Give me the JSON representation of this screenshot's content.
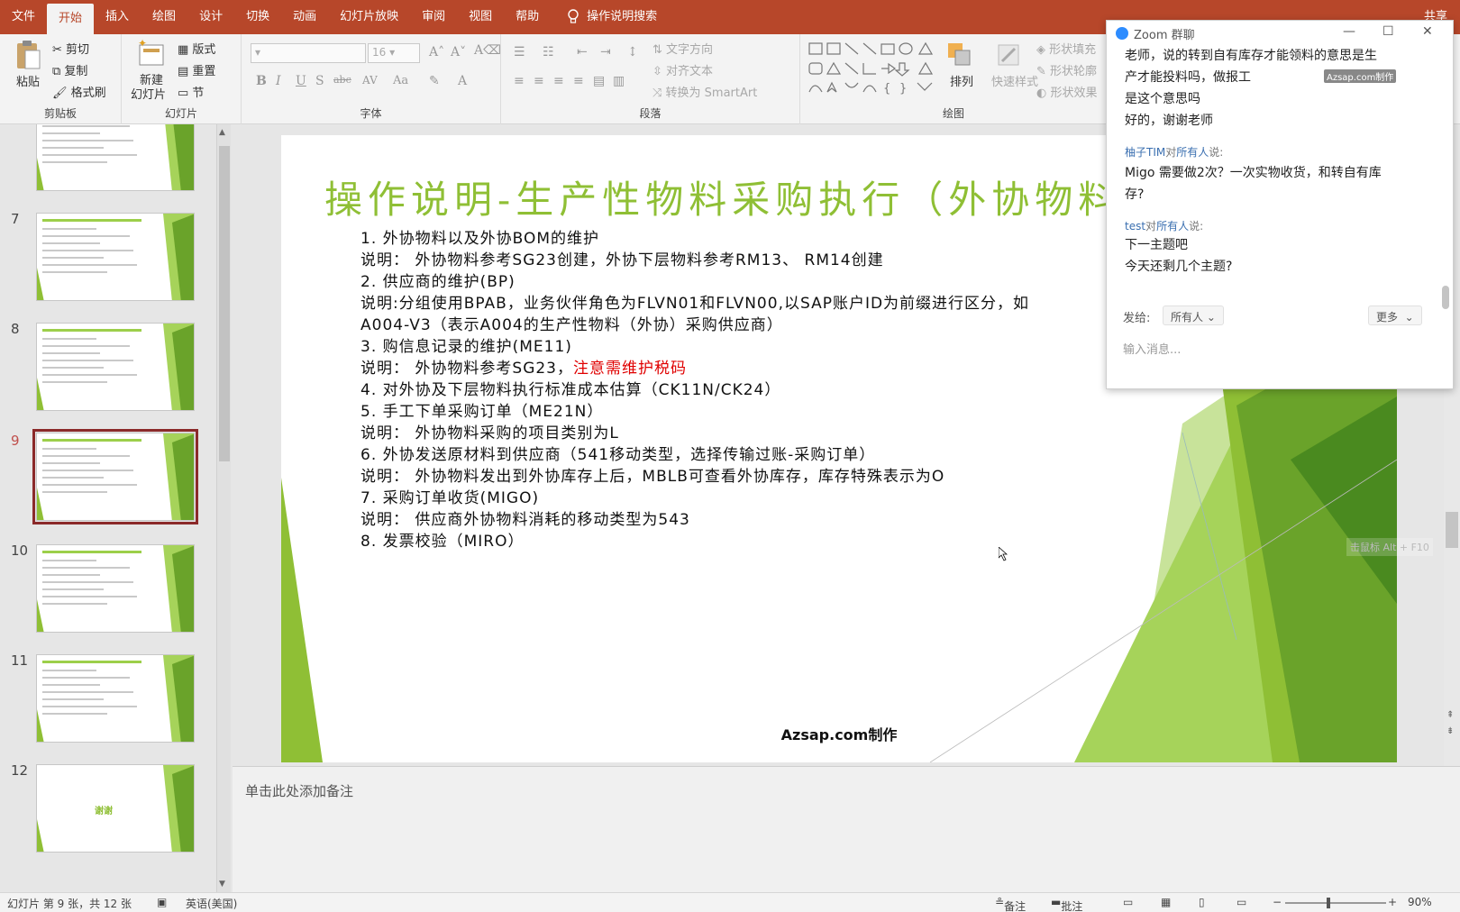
{
  "tabs": [
    "文件",
    "开始",
    "插入",
    "绘图",
    "设计",
    "切换",
    "动画",
    "幻灯片放映",
    "审阅",
    "视图",
    "帮助"
  ],
  "active_tab_index": 1,
  "tell_me": "操作说明搜索",
  "share": "共享",
  "ribbon": {
    "clipboard": {
      "label": "剪贴板",
      "paste": "粘贴",
      "cut": "剪切",
      "copy": "复制",
      "format_painter": "格式刷"
    },
    "slides": {
      "label": "幻灯片",
      "new_slide": "新建",
      "new_slide2": "幻灯片",
      "layout": "版式",
      "reset": "重置",
      "section": "节"
    },
    "font": {
      "label": "字体",
      "size": "16"
    },
    "paragraph": {
      "label": "段落",
      "text_direction": "文字方向",
      "align_text": "对齐文本",
      "convert_smartart": "转换为 SmartArt"
    },
    "drawing": {
      "label": "绘图",
      "arrange": "排列",
      "quick_styles": "快速样式",
      "shape_fill": "形状填充",
      "shape_outline": "形状轮廓",
      "shape_effects": "形状效果"
    }
  },
  "thumbnails": [
    {
      "num": "",
      "selected": false,
      "title_green": false
    },
    {
      "num": "7",
      "selected": false,
      "title_green": false
    },
    {
      "num": "8",
      "selected": false,
      "title_green": false
    },
    {
      "num": "9",
      "selected": true,
      "title_green": false
    },
    {
      "num": "10",
      "selected": false,
      "title_green": false
    },
    {
      "num": "11",
      "selected": false,
      "title_green": false
    },
    {
      "num": "12",
      "selected": false,
      "title_green": true
    }
  ],
  "thumb_end_text": "谢谢",
  "slide": {
    "title": "操作说明-生产性物料采购执行（外协物料）",
    "lines": [
      {
        "text": "1.  外协物料以及外协BOM的维护"
      },
      {
        "text": "说明： 外协物料参考SG23创建，外协下层物料参考RM13、 RM14创建"
      },
      {
        "text": "2. 供应商的维护(BP)"
      },
      {
        "text": "说明:分组使用BPAB，业务伙伴角色为FLVN01和FLVN00,以SAP账户ID为前缀进行区分，如"
      },
      {
        "text": "A004-V3（表示A004的生产性物料（外协）采购供应商）"
      },
      {
        "text": "3. 购信息记录的维护(ME11)"
      },
      {
        "text": "说明： 外协物料参考SG23，",
        "red": "注意需维护税码"
      },
      {
        "text": "4. 对外协及下层物料执行标准成本估算（CK11N/CK24）"
      },
      {
        "text": "5. 手工下单采购订单（ME21N）"
      },
      {
        "text": " 说明： 外协物料采购的项目类别为L"
      },
      {
        "text": "6. 外协发送原材料到供应商（541移动类型，选择传输过账-采购订单）"
      },
      {
        "text": "  说明： 外协物料发出到外协库存上后，MBLB可查看外协库存，库存特殊表示为O"
      },
      {
        "text": "7. 采购订单收货(MIGO)"
      },
      {
        "text": "  说明： 供应商外协物料消耗的移动类型为543"
      },
      {
        "text": "8. 发票校验（MIRO）"
      }
    ],
    "footer": "Azsap.com制作"
  },
  "notes_placeholder": "单击此处添加备注",
  "status": {
    "slide_info": "幻灯片 第 9 张，共 12 张",
    "language": "英语(美国)",
    "notes": "备注",
    "comments": "批注",
    "zoom": "90%"
  },
  "chat": {
    "title": "Zoom 群聊",
    "watermark": "Azsap.com制作",
    "messages": [
      {
        "text": "老师，说的转到自有库存才能领料的意思是生"
      },
      {
        "text": "产才能投料吗，做报工"
      },
      {
        "text": "是这个意思吗"
      },
      {
        "text": "好的，谢谢老师"
      }
    ],
    "sender1": {
      "name": "柚子TIM",
      "to": "对",
      "all": "所有人",
      "said": "说:"
    },
    "msg1a": "Migo 需要做2次？一次实物收货，和转自有库",
    "msg1b": "存?",
    "sender2": {
      "name": "test",
      "to": "对",
      "all": "所有人",
      "said": "说:"
    },
    "msg2a": "下一主题吧",
    "msg2b": "今天还剩几个主题?",
    "send_to_label": "发给:",
    "send_to_value": "所有人",
    "more": "更多",
    "input_placeholder": "输入消息..."
  },
  "hint": "击鼠标 Alt + F10",
  "colors": {
    "accent": "#b7472a",
    "slide_title": "#8fbf35",
    "dark_green": "#4a8a1f",
    "light_green": "#a6d35a"
  }
}
